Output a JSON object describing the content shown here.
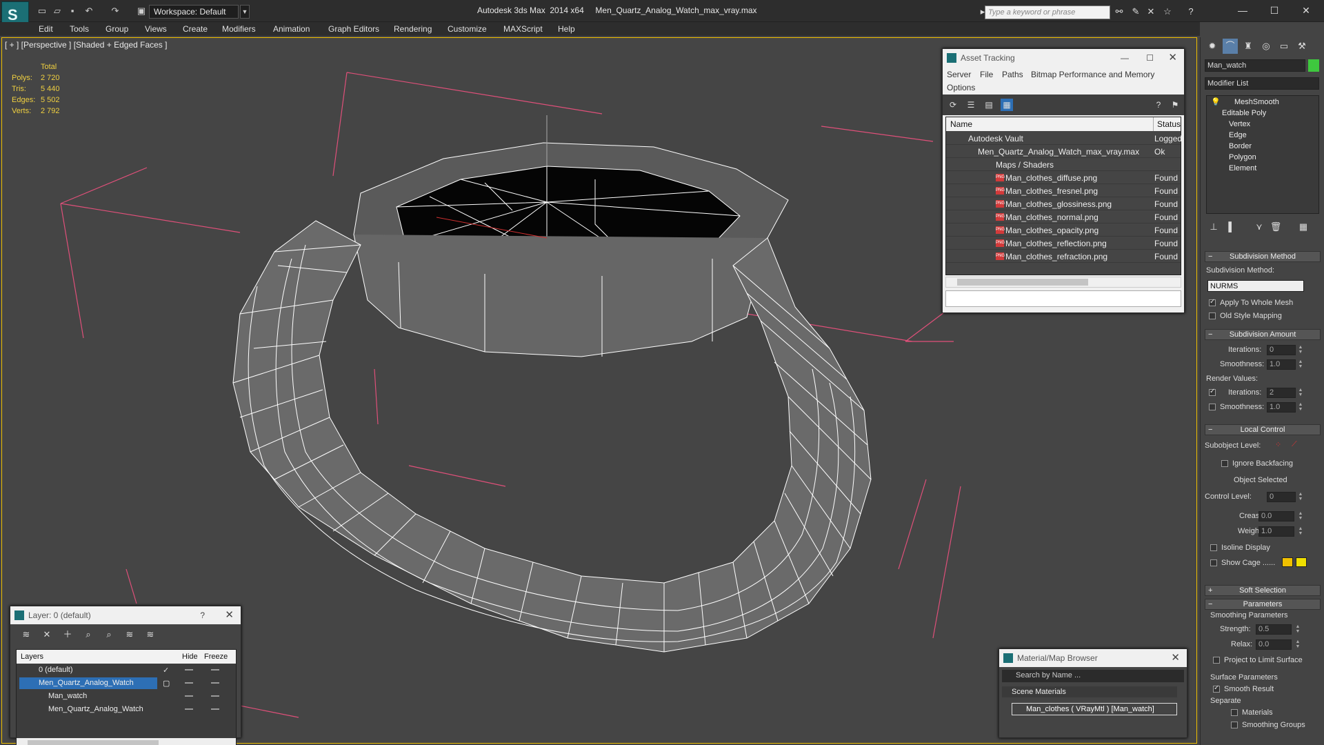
{
  "app": {
    "title": "Autodesk 3ds Max  2014 x64     Men_Quartz_Analog_Watch_max_vray.max",
    "workspace": "Workspace: Default",
    "search_placeholder": "Type a keyword or phrase",
    "colors": {
      "accent": "#f0c000",
      "viewport_bg": "#454545",
      "wire": "#ffffff",
      "grid": "#e0507a",
      "stats": "#f0d040"
    }
  },
  "menu": [
    "Edit",
    "Tools",
    "Group",
    "Views",
    "Create",
    "Modifiers",
    "Animation",
    "Graph Editors",
    "Rendering",
    "Customize",
    "MAXScript",
    "Help"
  ],
  "viewport": {
    "label": "[ + ] [Perspective ] [Shaded + Edged Faces ]",
    "stats": {
      "header": "Total",
      "rows": [
        {
          "label": "Polys:",
          "value": "2 720"
        },
        {
          "label": "Tris:",
          "value": "5 440"
        },
        {
          "label": "Edges:",
          "value": "5 502"
        },
        {
          "label": "Verts:",
          "value": "2 792"
        }
      ]
    }
  },
  "asset_tracking": {
    "title": "Asset Tracking",
    "menu": [
      "Server",
      "File",
      "Paths",
      "Bitmap Performance and Memory",
      "Options"
    ],
    "columns": [
      "Name",
      "Status"
    ],
    "rows": [
      {
        "name": "Autodesk Vault",
        "status": "Logged"
      },
      {
        "name": "Men_Quartz_Analog_Watch_max_vray.max",
        "status": "Ok"
      },
      {
        "name": "Maps / Shaders",
        "status": ""
      },
      {
        "name": "Man_clothes_diffuse.png",
        "status": "Found"
      },
      {
        "name": "Man_clothes_fresnel.png",
        "status": "Found"
      },
      {
        "name": "Man_clothes_glossiness.png",
        "status": "Found"
      },
      {
        "name": "Man_clothes_normal.png",
        "status": "Found"
      },
      {
        "name": "Man_clothes_opacity.png",
        "status": "Found"
      },
      {
        "name": "Man_clothes_reflection.png",
        "status": "Found"
      },
      {
        "name": "Man_clothes_refraction.png",
        "status": "Found"
      }
    ],
    "png_badge": "PNG"
  },
  "command_panel": {
    "object_name": "Man_watch",
    "modifier_list": "Modifier List",
    "stack": [
      "MeshSmooth",
      "Editable Poly",
      "Vertex",
      "Edge",
      "Border",
      "Polygon",
      "Element"
    ],
    "subdivision_method": {
      "title": "Subdivision Method",
      "label": "Subdivision Method:",
      "value": "NURMS",
      "apply_whole_mesh": "Apply To Whole Mesh",
      "old_style": "Old Style Mapping"
    },
    "subdivision_amount": {
      "title": "Subdivision Amount",
      "iterations_label": "Iterations:",
      "iterations": "0",
      "smoothness_label": "Smoothness:",
      "smoothness": "1.0",
      "render_values": "Render Values:",
      "render_iterations": "2",
      "render_smoothness": "1.0"
    },
    "local_control": {
      "title": "Local Control",
      "subobject_level": "Subobject Level:",
      "ignore_backfacing": "Ignore Backfacing",
      "object_selected": "Object Selected",
      "control_level_label": "Control Level:",
      "control_level": "0",
      "crease_label": "Crease:",
      "crease": "0.0",
      "weight_label": "Weight:",
      "weight": "1.0",
      "isoline": "Isoline Display",
      "show_cage": "Show Cage ......"
    },
    "soft_selection": "Soft Selection",
    "parameters": {
      "title": "Parameters",
      "smoothing_parameters": "Smoothing Parameters",
      "strength_label": "Strength:",
      "strength": "0.5",
      "relax_label": "Relax:",
      "relax": "0.0",
      "project": "Project to Limit Surface",
      "surface_parameters": "Surface Parameters",
      "smooth_result": "Smooth Result",
      "separate": "Separate",
      "materials": "Materials",
      "smoothing_groups": "Smoothing Groups"
    }
  },
  "layer_panel": {
    "title": "Layer: 0 (default)",
    "help": "?",
    "columns": [
      "Layers",
      "Hide",
      "Freeze"
    ],
    "rows": [
      {
        "name": "0 (default)"
      },
      {
        "name": "Men_Quartz_Analog_Watch"
      },
      {
        "name": "Man_watch"
      },
      {
        "name": "Men_Quartz_Analog_Watch"
      }
    ]
  },
  "material_browser": {
    "title": "Material/Map Browser",
    "search_placeholder": "Search by Name ...",
    "scene_materials": "Scene Materials",
    "material": "Man_clothes  ( VRayMtl ) [Man_watch]"
  }
}
